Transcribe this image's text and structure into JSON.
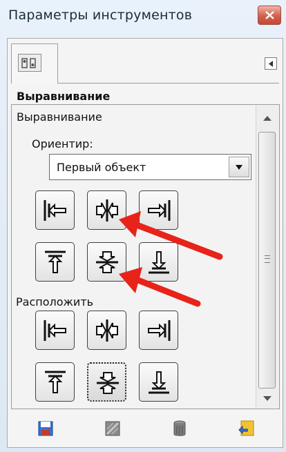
{
  "window": {
    "title": "Параметры инструментов"
  },
  "tab": {
    "icon": "tool-options-icon"
  },
  "alignment": {
    "header_title": "Выравнивание",
    "section_title": "Выравнивание",
    "reference_label": "Ориентир:",
    "reference_value": "Первый объект",
    "align_buttons": [
      {
        "name": "align-left-edge",
        "icon": "align-left-icon"
      },
      {
        "name": "align-center-horizontal",
        "icon": "align-hcenter-icon"
      },
      {
        "name": "align-right-edge",
        "icon": "align-right-icon"
      },
      {
        "name": "align-top-edge",
        "icon": "align-top-icon"
      },
      {
        "name": "align-center-vertical",
        "icon": "align-vcenter-icon"
      },
      {
        "name": "align-bottom-edge",
        "icon": "align-bottom-icon"
      }
    ]
  },
  "distribute": {
    "label": "Расположить",
    "selected_button": "distribute-vcenter"
  },
  "bottom_toolbar": {
    "icons": [
      "save-icon",
      "restore-icon",
      "delete-icon",
      "reset-icon"
    ]
  },
  "colors": {
    "annotation_arrow": "#e8231a",
    "close_button": "#d0604c"
  }
}
